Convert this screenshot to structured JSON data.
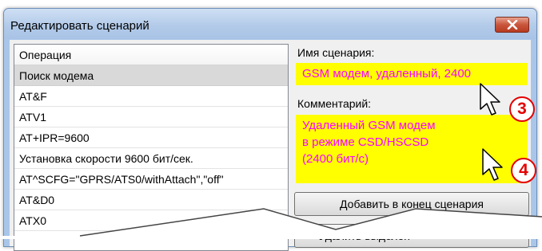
{
  "window": {
    "title": "Редактировать сценарий"
  },
  "operations": {
    "header": "Операция",
    "items": [
      "Поиск модема",
      "AT&F",
      "ATV1",
      "AT+IPR=9600",
      "Установка скорости 9600 бит/сек.",
      "AT^SCFG=\"GPRS/ATS0/withAttach\",\"off\"",
      "AT&D0",
      "ATX0"
    ],
    "selected_index": 0
  },
  "scenario": {
    "name_label": "Имя сценария:",
    "name_value": "GSM модем, удаленный, 2400",
    "comment_label": "Комментарий:",
    "comment_value": "Удаленный GSM модем\nв режиме CSD/HSCSD\n(2400 бит/с)"
  },
  "buttons": {
    "add_to_end": "Добавить в конец сценария",
    "delete_selected": "Удалить выделен"
  },
  "callouts": [
    "3",
    "4"
  ],
  "colors": {
    "highlight_bg": "#ffff00",
    "highlight_text": "#ff00ff",
    "callout": "#e30000"
  },
  "icons": {
    "close": "close-icon",
    "cursor": "arrow-cursor-icon"
  }
}
